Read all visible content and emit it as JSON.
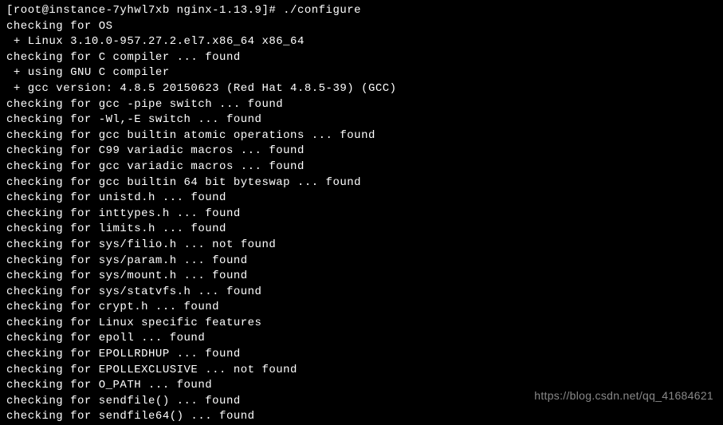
{
  "terminal": {
    "lines": [
      "[root@instance-7yhwl7xb nginx-1.13.9]# ./configure",
      "checking for OS",
      " + Linux 3.10.0-957.27.2.el7.x86_64 x86_64",
      "checking for C compiler ... found",
      " + using GNU C compiler",
      " + gcc version: 4.8.5 20150623 (Red Hat 4.8.5-39) (GCC)",
      "checking for gcc -pipe switch ... found",
      "checking for -Wl,-E switch ... found",
      "checking for gcc builtin atomic operations ... found",
      "checking for C99 variadic macros ... found",
      "checking for gcc variadic macros ... found",
      "checking for gcc builtin 64 bit byteswap ... found",
      "checking for unistd.h ... found",
      "checking for inttypes.h ... found",
      "checking for limits.h ... found",
      "checking for sys/filio.h ... not found",
      "checking for sys/param.h ... found",
      "checking for sys/mount.h ... found",
      "checking for sys/statvfs.h ... found",
      "checking for crypt.h ... found",
      "checking for Linux specific features",
      "checking for epoll ... found",
      "checking for EPOLLRDHUP ... found",
      "checking for EPOLLEXCLUSIVE ... not found",
      "checking for O_PATH ... found",
      "checking for sendfile() ... found",
      "checking for sendfile64() ... found"
    ]
  },
  "watermark": {
    "text": "https://blog.csdn.net/qq_41684621"
  }
}
